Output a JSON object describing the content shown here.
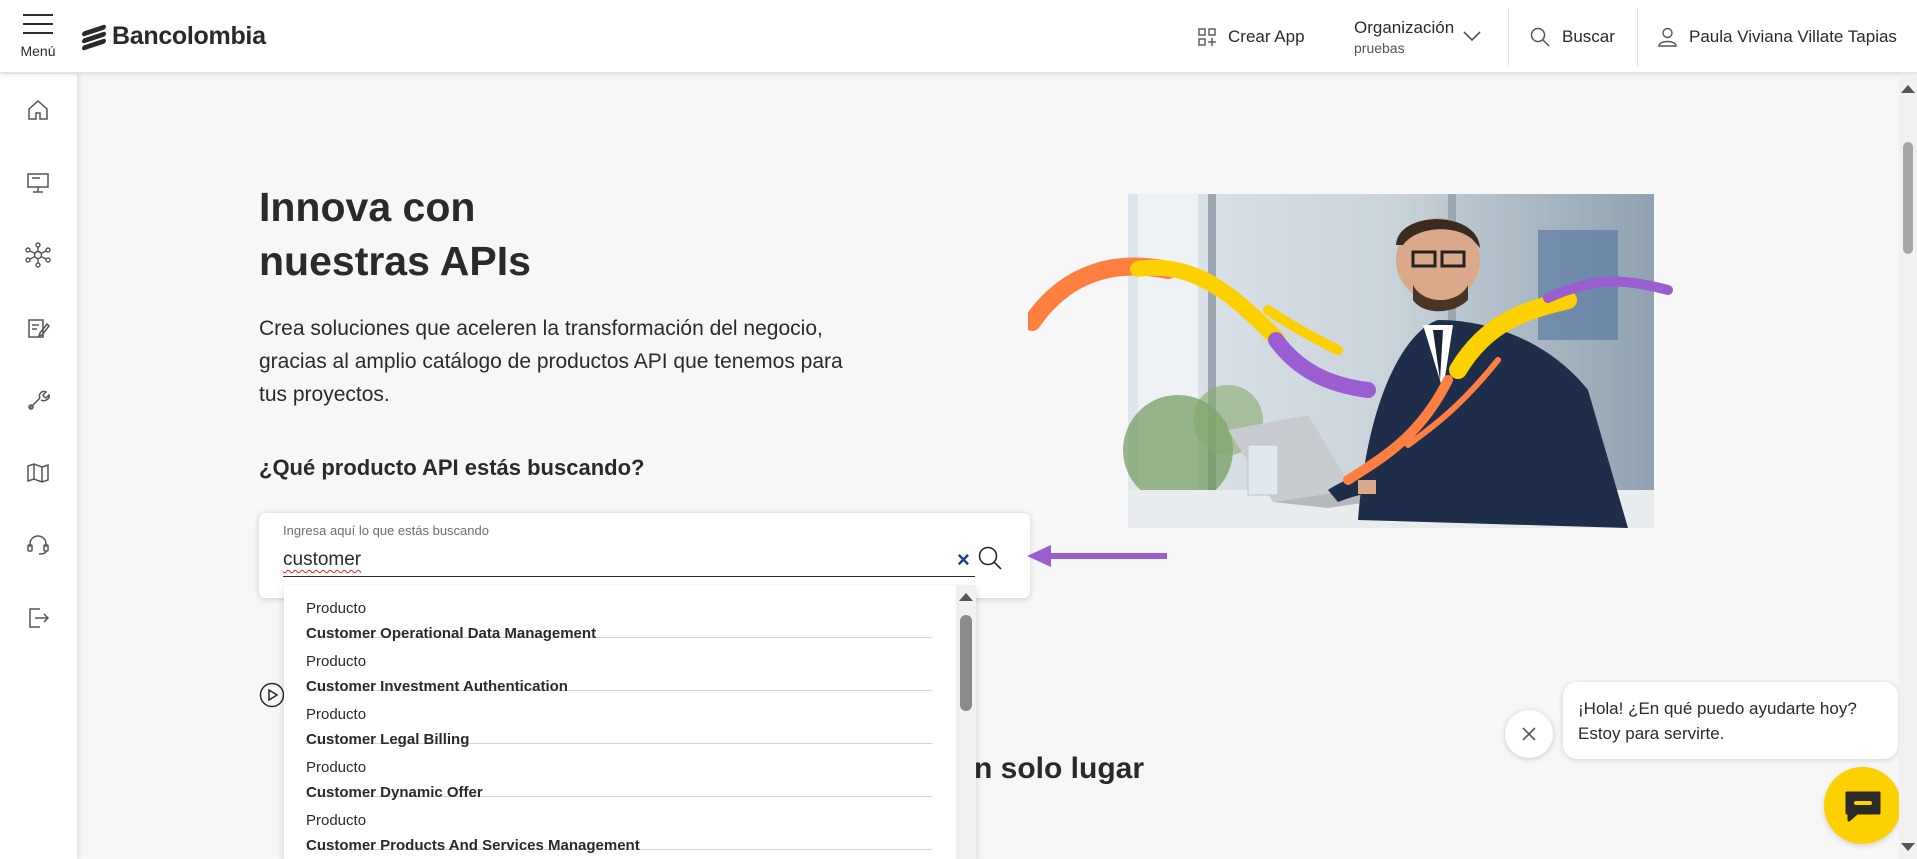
{
  "header": {
    "menu_label": "Menú",
    "brand": "Bancolombia",
    "create_app": "Crear App",
    "org_title": "Organización",
    "org_value": "pruebas",
    "search_label": "Buscar",
    "user_name": "Paula Viviana Villate Tapias"
  },
  "sidebar": {
    "icons": [
      "home-icon",
      "monitor-icon",
      "network-icon",
      "document-edit-icon",
      "tools-icon",
      "map-icon",
      "headset-icon",
      "logout-icon"
    ]
  },
  "hero": {
    "title_line1": "Innova con",
    "title_line2": "nuestras APIs",
    "description": "Crea soluciones que aceleren la transformación del negocio, gracias al amplio catálogo de productos API que tenemos para tus proyectos."
  },
  "search": {
    "question": "¿Qué producto API estás buscando?",
    "placeholder": "Ingresa aquí lo que estás buscando",
    "value": "customer",
    "clear": "×"
  },
  "results": [
    {
      "category": "Producto",
      "name": "Customer Operational Data Management"
    },
    {
      "category": "Producto",
      "name": "Customer Investment Authentication"
    },
    {
      "category": "Producto",
      "name": "Customer Legal Billing"
    },
    {
      "category": "Producto",
      "name": "Customer Dynamic Offer"
    },
    {
      "category": "Producto",
      "name": "Customer Products And Services Management"
    }
  ],
  "section2_partial": "n solo lugar",
  "chat": {
    "line1": "¡Hola! ¿En qué puedo ayudarte hoy?",
    "line2": "Estoy para servirte."
  },
  "colors": {
    "brand_yellow": "#fdd000",
    "accent_purple": "#9b5ed0",
    "accent_orange": "#ff7f41",
    "clear_blue": "#1f3b8a"
  }
}
